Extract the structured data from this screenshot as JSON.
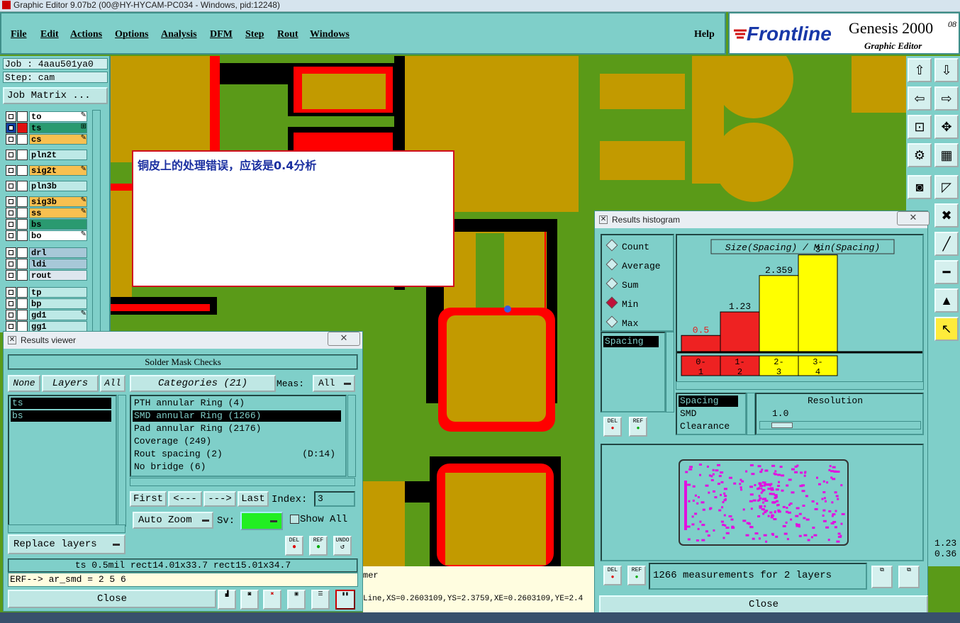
{
  "window": {
    "title": "Graphic Editor 9.07b2 (00@HY-HYCAM-PC034 - Windows, pid:12248)"
  },
  "menu": {
    "items": [
      "File",
      "Edit",
      "Actions",
      "Options",
      "Analysis",
      "DFM",
      "Step",
      "Rout",
      "Windows"
    ],
    "help": "Help"
  },
  "brand": {
    "logo": "Frontline",
    "product": "Genesis 2000",
    "version_fragment": "08",
    "subtitle": "Graphic Editor"
  },
  "job": {
    "job_line": "Job : 4aau501ya0",
    "step_line": "Step: cam",
    "matrix_button": "Job Matrix ..."
  },
  "layers": [
    {
      "name": "to",
      "color": "#ffffff",
      "edit": "✎"
    },
    {
      "name": "ts",
      "color": "#2a9a70",
      "edit": "⊞",
      "active": true
    },
    {
      "name": "cs",
      "color": "#f8c050",
      "edit": "✎"
    },
    {
      "name": "pln2t",
      "color": "#bde9e6",
      "edit": ""
    },
    {
      "name": "sig2t",
      "color": "#f8c050",
      "edit": "✎"
    },
    {
      "name": "pln3b",
      "color": "#bde9e6",
      "edit": ""
    },
    {
      "name": "sig3b",
      "color": "#f8c050",
      "edit": "✎"
    },
    {
      "name": "ss",
      "color": "#f8c050",
      "edit": "✎"
    },
    {
      "name": "bs",
      "color": "#2a9a70",
      "edit": ""
    },
    {
      "name": "bo",
      "color": "#ffffff",
      "edit": "✎"
    },
    {
      "name": "drl",
      "color": "#a7c8d8",
      "edit": ""
    },
    {
      "name": "ldi",
      "color": "#a7c8d8",
      "edit": ""
    },
    {
      "name": "rout",
      "color": "#dde6ee",
      "edit": ""
    },
    {
      "name": "tp",
      "color": "#bde9e6",
      "edit": ""
    },
    {
      "name": "bp",
      "color": "#bde9e6",
      "edit": ""
    },
    {
      "name": "gd1",
      "color": "#bde9e6",
      "edit": "✎"
    },
    {
      "name": "gg1",
      "color": "#bde9e6",
      "edit": ""
    }
  ],
  "message": {
    "text": "铜皮上的处理错误，应该是0.4分析"
  },
  "results_viewer": {
    "title": "Results viewer",
    "close_x": "✕",
    "header": "Solder Mask Checks",
    "none_btn": "None",
    "layers_btn": "Layers",
    "all_btn": "All",
    "categories_btn": "Categories (21)",
    "meas_label": "Meas:",
    "meas_value": "All",
    "layer_list": [
      "ts",
      "bs"
    ],
    "categories": [
      {
        "label": "PTH annular Ring (4)",
        "extra": ""
      },
      {
        "label": "SMD annular Ring (1266)",
        "extra": "",
        "selected": true
      },
      {
        "label": "Pad annular Ring (2176)",
        "extra": ""
      },
      {
        "label": "Coverage (249)",
        "extra": ""
      },
      {
        "label": "Rout spacing (2)",
        "extra": "(D:14)"
      },
      {
        "label": "No bridge (6)",
        "extra": ""
      }
    ],
    "first_btn": "First",
    "prev_btn": "<---",
    "next_btn": "--->",
    "last_btn": "Last",
    "index_label": "Index:",
    "index_value": "3",
    "zoom_btn": "Auto Zoom",
    "sv_label": "Sv:",
    "show_all": "Show All",
    "replace_btn": "Replace layers",
    "del": "DEL",
    "ref": "REF",
    "undo": "UNDO",
    "status": "ts 0.5mil  rect14.01x33.7  rect15.01x34.7",
    "erf": "ERF--> ar_smd = 2 5 6",
    "close": "Close"
  },
  "histogram": {
    "title": "Results histogram",
    "close_x": "✕",
    "modes": [
      "Count",
      "Average",
      "Sum",
      "Min",
      "Max"
    ],
    "selected_mode": "Min",
    "chart_title": "Size(Spacing) / Min(Spacing)",
    "list": [
      "Spacing"
    ],
    "chart_data": {
      "type": "bar",
      "categories": [
        "0-\n1",
        "1-\n2",
        "2-\n3",
        "3-\n4"
      ],
      "values": [
        0.5,
        1.23,
        2.359,
        3
      ],
      "labels": [
        "0.5",
        "1.23",
        "2.359",
        "3"
      ],
      "colors": [
        "#ee2222",
        "#ee2222",
        "#ffff00",
        "#ffff00"
      ],
      "ylim": [
        0,
        3.3
      ]
    },
    "attr_list": [
      "Spacing",
      "SMD",
      "Clearance"
    ],
    "resolution_label": "Resolution",
    "resolution_value": "1.0",
    "summary": "1266 measurements for 2 layers",
    "close": "Close"
  },
  "statusbar": {
    "coords": "Line,XS=0.2603109,YS=2.3759,XE=0.2603109,YE=2.4",
    "partial": "mer",
    "right_values": [
      "1.23",
      "0.36"
    ]
  }
}
